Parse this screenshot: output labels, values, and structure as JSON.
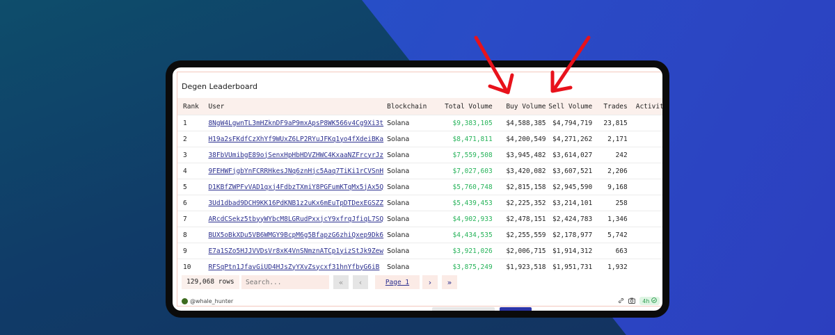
{
  "board": {
    "title": "Degen Leaderboard",
    "columns": [
      "Rank",
      "User",
      "Blockchain",
      "Total Volume",
      "Buy Volume",
      "Sell Volume",
      "Trades",
      "Activity Da"
    ]
  },
  "rows": [
    {
      "rank": "1",
      "user": "8NgW4LgwnTL3mHZknDF9aP9mxApsP8WK566v4Cg9Xi3t",
      "chain": "Solana",
      "total": "$9,383,105",
      "buy": "$4,588,385",
      "sell": "$4,794,719",
      "trades": "23,815"
    },
    {
      "rank": "2",
      "user": "H19a2sFKdfCzXhYf9WUxZ6LP2RYuJFKq1yo4fXdeiBKa",
      "chain": "Solana",
      "total": "$8,471,811",
      "buy": "$4,200,549",
      "sell": "$4,271,262",
      "trades": "2,171"
    },
    {
      "rank": "3",
      "user": "38FbVUmibgE89ojSenxHpHbHDVZHWC4KxaaNZFrcyrJz",
      "chain": "Solana",
      "total": "$7,559,508",
      "buy": "$3,945,482",
      "sell": "$3,614,027",
      "trades": "242"
    },
    {
      "rank": "4",
      "user": "9FEHWFjgbYnFCRRHkesJNq6znHjc5Aaq7TiKi1rCVSnH",
      "chain": "Solana",
      "total": "$7,027,603",
      "buy": "$3,420,082",
      "sell": "$3,607,521",
      "trades": "2,206"
    },
    {
      "rank": "5",
      "user": "D1KBfZWPFvVAD1qxj4FdbzTXmiY8PGFumKTqMx5jAx5Q",
      "chain": "Solana",
      "total": "$5,760,748",
      "buy": "$2,815,158",
      "sell": "$2,945,590",
      "trades": "9,168"
    },
    {
      "rank": "6",
      "user": "3Ud1dbad9DCH9KK16PdKNB1z2uKx6mEuTpDTDexEGSZZ",
      "chain": "Solana",
      "total": "$5,439,453",
      "buy": "$2,225,352",
      "sell": "$3,214,101",
      "trades": "258"
    },
    {
      "rank": "7",
      "user": "ARcdCSekz5tbyyWYbcM8LGRudPxxjcY9xfrqJfiqL7SQ",
      "chain": "Solana",
      "total": "$4,902,933",
      "buy": "$2,478,151",
      "sell": "$2,424,783",
      "trades": "1,346"
    },
    {
      "rank": "8",
      "user": "BUX5oBkXDu5VB6WMGY9BcpM6g5BfapzG6zhiQxep9Dk6",
      "chain": "Solana",
      "total": "$4,434,535",
      "buy": "$2,255,559",
      "sell": "$2,178,977",
      "trades": "5,742"
    },
    {
      "rank": "9",
      "user": "E7a1SZo5HJJVVDsVr8xK4VnSNmznATCp1yizStJk9Zew",
      "chain": "Solana",
      "total": "$3,921,026",
      "buy": "$2,006,715",
      "sell": "$1,914,312",
      "trades": "663"
    },
    {
      "rank": "10",
      "user": "RFSqPtn1JfavGiUD4HJsZyYXvZsycxf31hnYfbyG6iB",
      "chain": "Solana",
      "total": "$3,875,249",
      "buy": "$1,923,518",
      "sell": "$1,951,731",
      "trades": "1,932"
    }
  ],
  "footer": {
    "row_count": "129,068 rows",
    "search_placeholder": "Search...",
    "first_page": "«",
    "prev_page": "‹",
    "page_label": "Page 1",
    "next_page": "›",
    "last_page": "»"
  },
  "meta": {
    "author": "@whale_hunter",
    "age": "4h",
    "link_icon": "link-icon",
    "camera_icon": "camera-icon",
    "check_icon": "check-circle-icon"
  },
  "colors": {
    "positive": "#27b35a",
    "link": "#2b2f8f",
    "header_bg": "#fbf0ec",
    "annotation_arrow": "#e8121b"
  }
}
